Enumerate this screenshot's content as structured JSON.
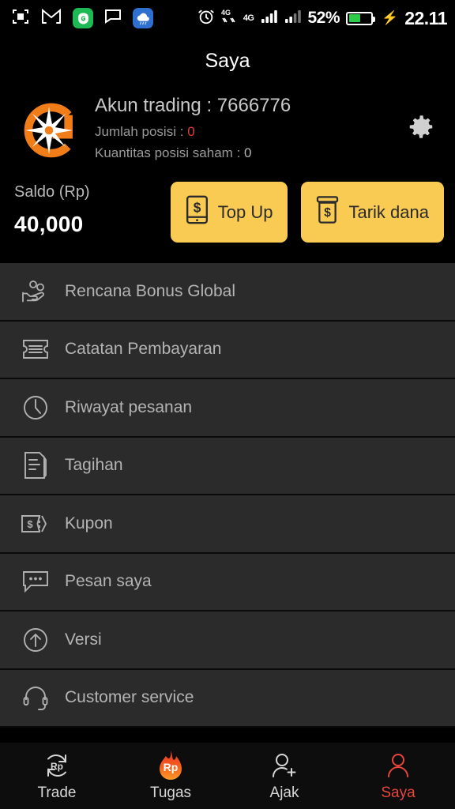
{
  "statusbar": {
    "icons_left": [
      "screenshot-icon",
      "gmail-icon",
      "gpay-icon",
      "chat-icon",
      "weather-icon"
    ],
    "alarm_icon": "alarm-icon",
    "vpn_icon": "4g-vpn-icon",
    "network_label": "4G",
    "signal_icon_1": "signal-bars-icon",
    "signal_icon_2": "signal-bars-icon",
    "battery_percent": "52%",
    "battery_level": 52,
    "charging_icon": "charging-bolt-icon",
    "time": "22.11"
  },
  "header": {
    "title": "Saya",
    "settings_icon": "gear-icon"
  },
  "account": {
    "logo_icon": "compass-g-logo",
    "trading_label": "Akun trading",
    "trading_separator": ":",
    "trading_number": "7666776",
    "positions_label": "Jumlah posisi",
    "positions_separator": ":",
    "positions_value": "0",
    "shares_label": "Kuantitas posisi saham",
    "shares_separator": ":",
    "shares_value": "0"
  },
  "balance": {
    "label": "Saldo (Rp)",
    "value": "40,000",
    "topup_label": "Top Up",
    "topup_icon": "phone-dollar-icon",
    "withdraw_label": "Tarik dana",
    "withdraw_icon": "jar-dollar-icon"
  },
  "menu": {
    "items": [
      {
        "label": "Rencana Bonus Global",
        "icon": "hand-coins-icon"
      },
      {
        "label": "Catatan Pembayaran",
        "icon": "ticket-lines-icon"
      },
      {
        "label": "Riwayat pesanan",
        "icon": "clock-icon"
      },
      {
        "label": "Tagihan",
        "icon": "document-lines-icon"
      },
      {
        "label": "Kupon",
        "icon": "coupon-dollar-icon"
      },
      {
        "label": "Pesan saya",
        "icon": "chat-bubble-icon"
      },
      {
        "label": "Versi",
        "icon": "arrow-up-circle-icon"
      },
      {
        "label": "Customer service",
        "icon": "headset-icon"
      }
    ]
  },
  "bottomnav": {
    "active_color": "#e8453c",
    "items": [
      {
        "label": "Trade",
        "icon": "rp-refresh-icon",
        "active": false
      },
      {
        "label": "Tugas",
        "icon": "rp-flame-icon",
        "active": false
      },
      {
        "label": "Ajak",
        "icon": "user-plus-icon",
        "active": false
      },
      {
        "label": "Saya",
        "icon": "user-icon",
        "active": true
      }
    ]
  }
}
